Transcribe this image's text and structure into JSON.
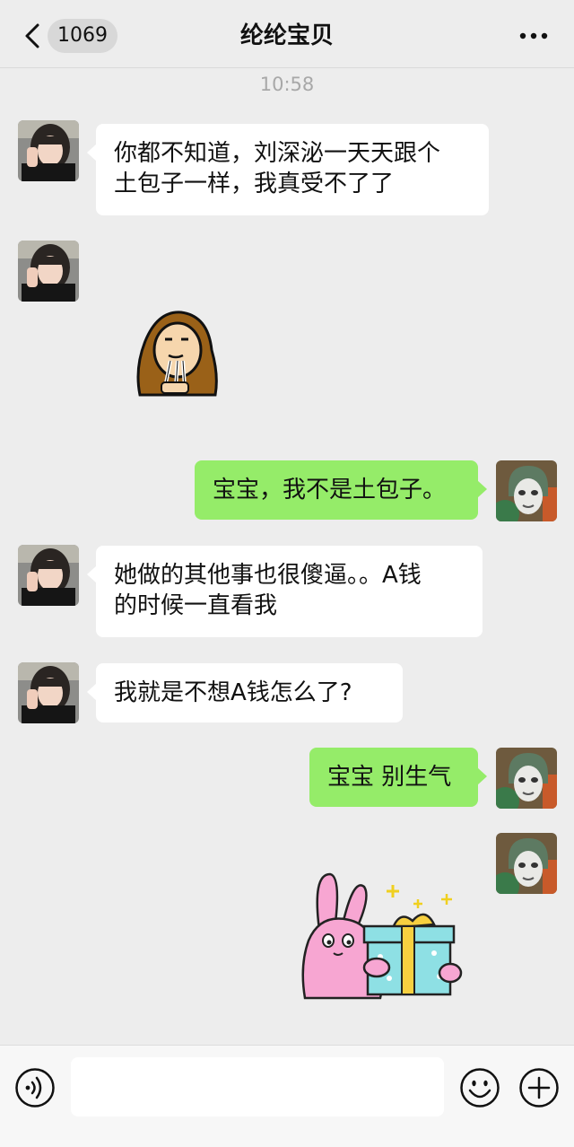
{
  "header": {
    "unread_count": "1069",
    "title": "纶纶宝贝"
  },
  "chat": {
    "timestamp": "10:58",
    "messages": [
      {
        "side": "left",
        "type": "text",
        "text_line1": "你都不知道，刘深泌一天天跟个",
        "text_line2": "土包子一样，我真受不了了"
      },
      {
        "side": "left",
        "type": "sticker",
        "sticker": "brown-hood-drooling-guy"
      },
      {
        "side": "right",
        "type": "text",
        "text": "宝宝，我不是土包子。"
      },
      {
        "side": "left",
        "type": "text",
        "text_line1": "她做的其他事也很傻逼。。A钱",
        "text_line2": "的时候一直看我"
      },
      {
        "side": "left",
        "type": "text",
        "text": "我就是不想A钱怎么了?"
      },
      {
        "side": "right",
        "type": "text",
        "text": "宝宝 别生气"
      },
      {
        "side": "right",
        "type": "sticker",
        "sticker": "pink-bunny-gift-box"
      }
    ]
  },
  "input_bar": {
    "placeholder": ""
  },
  "colors": {
    "background": "#ededed",
    "bubble_self": "#95ec69",
    "bubble_other": "#ffffff",
    "timestamp": "#a8a8a8"
  },
  "icons": [
    "back-icon",
    "more-icon",
    "voice-icon",
    "emoji-icon",
    "plus-icon"
  ]
}
